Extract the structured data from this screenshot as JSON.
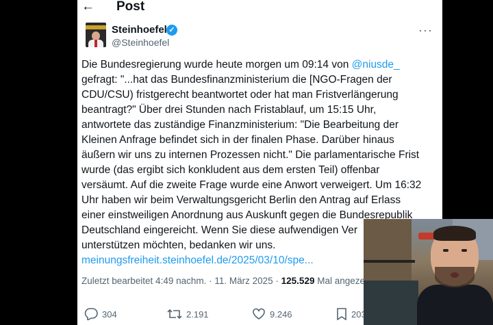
{
  "header": {
    "back_icon": "arrow-left-icon",
    "title": "Post"
  },
  "author": {
    "name": "Steinhoefel",
    "handle": "@Steinhoefel",
    "verified": true
  },
  "tweet": {
    "lines": [
      [
        "Die Bundesregierung wurde heute morgen um 09:14 von ",
        "@niusde_"
      ],
      [
        "gefragt: \"...hat das Bundesfinanzministerium die [NGO-Fragen der"
      ],
      [
        "CDU/CSU) fristgerecht beantwortet oder hat man Fristverlängerung"
      ],
      [
        "beantragt?\" Über drei Stunden nach Fristablauf, um 15:15 Uhr,"
      ],
      [
        "antwortete das zuständige Finanzministerium: \"Die Bearbeitung der"
      ],
      [
        "Kleinen Anfrage befindet sich in der finalen Phase. Darüber hinaus"
      ],
      [
        "äußern wir uns zu internen Prozessen nicht.\" Die parlamentarische Frist"
      ],
      [
        "wurde (das ergibt sich konkludent aus dem ersten Teil) offenbar"
      ],
      [
        "versäumt. Auf die zweite Frage wurde eine Anwort verweigert. Um 16:32"
      ],
      [
        "Uhr haben wir beim Verwaltungsgericht Berlin den Antrag auf Erlass"
      ],
      [
        "einer einstweiligen Anordnung aus Auskunft gegen die Bundesrepublik"
      ],
      [
        "Deutschland eingereicht. Wenn Sie diese aufwendigen Ver"
      ],
      [
        "unterstützen möchten, bedanken wir uns."
      ]
    ],
    "link": "meinungsfreiheit.steinhoefel.de/2025/03/10/spe..."
  },
  "meta": {
    "edited": "Zuletzt bearbeitet 4:49 nachm. · 11. März 2025 · ",
    "views": "125.529",
    "views_label": " Mal angeze"
  },
  "actions": {
    "replies": "304",
    "reposts": "2.191",
    "likes": "9.246",
    "bookmarks": "203"
  },
  "colors": {
    "accent": "#1d9bf0",
    "text": "#0f1419",
    "muted": "#536471"
  }
}
